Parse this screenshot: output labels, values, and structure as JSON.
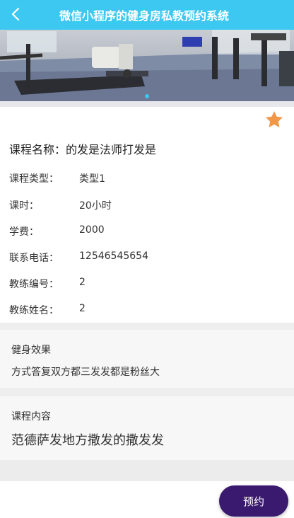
{
  "header": {
    "title": "微信小程序的健身房私教预约系统"
  },
  "icons": {
    "back": "chevron-left-icon",
    "favorite": "star-icon",
    "favorite_color": "#f0974a"
  },
  "banner": {
    "description_icon": "gym-photo",
    "active_dot_color": "#3cc8f0"
  },
  "course": {
    "name_label": "课程名称：",
    "name_value": "的发是法师打发是",
    "fields": [
      {
        "label": "课程类型：",
        "value": "类型1"
      },
      {
        "label": "课时：",
        "value": "20小时"
      },
      {
        "label": "学费：",
        "value": "2000"
      },
      {
        "label": "联系电话：",
        "value": "12546545654"
      },
      {
        "label": "教练编号：",
        "value": "2"
      },
      {
        "label": "教练姓名：",
        "value": "2"
      }
    ]
  },
  "effect": {
    "label": "健身效果",
    "text": "方式答复双方都三发发都是粉丝大"
  },
  "content": {
    "label": "课程内容",
    "text": "范德萨发地方撒发的撒发发"
  },
  "actions": {
    "book_label": "预约",
    "book_color": "#3a1a6e"
  }
}
